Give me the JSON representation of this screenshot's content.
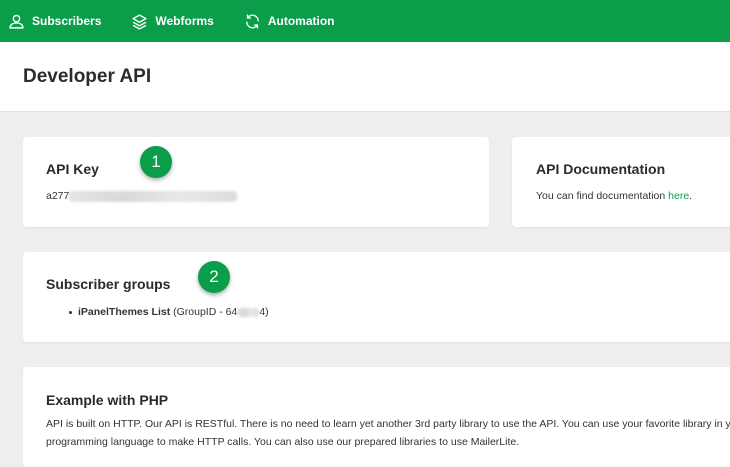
{
  "nav": {
    "subscribers": "Subscribers",
    "webforms": "Webforms",
    "automation": "Automation"
  },
  "header": {
    "title": "Developer API"
  },
  "api_key": {
    "title": "API Key",
    "prefix": "a277",
    "badge": "1"
  },
  "api_docs": {
    "title": "API Documentation",
    "text_before": "You can find documentation ",
    "link": "here",
    "text_after": "."
  },
  "groups": {
    "title": "Subscriber groups",
    "badge": "2",
    "items": [
      {
        "name": "iPanelThemes List",
        "id_prefix": "(GroupID - 64",
        "id_suffix": "4)"
      }
    ]
  },
  "example": {
    "title": "Example with PHP",
    "line1": "API is built on HTTP. Our API is RESTful. There is no need to learn yet another 3rd party library to use the API. You can use your favorite library in your",
    "line2": "programming language to make HTTP calls. You can also use our prepared libraries to use MailerLite."
  },
  "colors": {
    "brand_green": "#0a9d4a",
    "background": "#eeeeee"
  }
}
